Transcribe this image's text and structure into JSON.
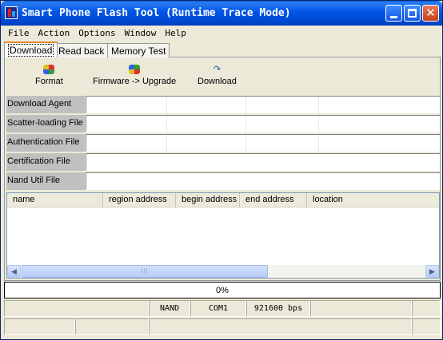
{
  "window": {
    "title": "Smart Phone Flash Tool (Runtime Trace Mode)"
  },
  "menu": [
    "File",
    "Action",
    "Options",
    "Window",
    "Help"
  ],
  "tabs": [
    "Download",
    "Read back",
    "Memory Test"
  ],
  "toolbar": {
    "format_label": "Format",
    "upgrade_label": "Firmware -> Upgrade",
    "download_label": "Download",
    "format_icon": "format-icon",
    "upgrade_icon": "upgrade-icon",
    "download_icon": "download-arrow-icon"
  },
  "files": {
    "download_agent": {
      "label": "Download Agent",
      "value": ""
    },
    "scatter_loading": {
      "label": "Scatter-loading File",
      "value": ""
    },
    "authentication": {
      "label": "Authentication File",
      "value": ""
    },
    "certification": {
      "label": "Certification File",
      "value": ""
    },
    "nand_util": {
      "label": "Nand Util File",
      "value": ""
    }
  },
  "table": {
    "columns": [
      "name",
      "region address",
      "begin address",
      "end address",
      "location"
    ],
    "rows": []
  },
  "progress": {
    "value": 0,
    "text": "0%"
  },
  "status": {
    "storage": "NAND",
    "port": "COM1",
    "baud": "921600 bps"
  },
  "colors": {
    "titlebar": "#0055e5",
    "progress_fill": "#0a246a",
    "label_bg": "#c0c0c0"
  }
}
